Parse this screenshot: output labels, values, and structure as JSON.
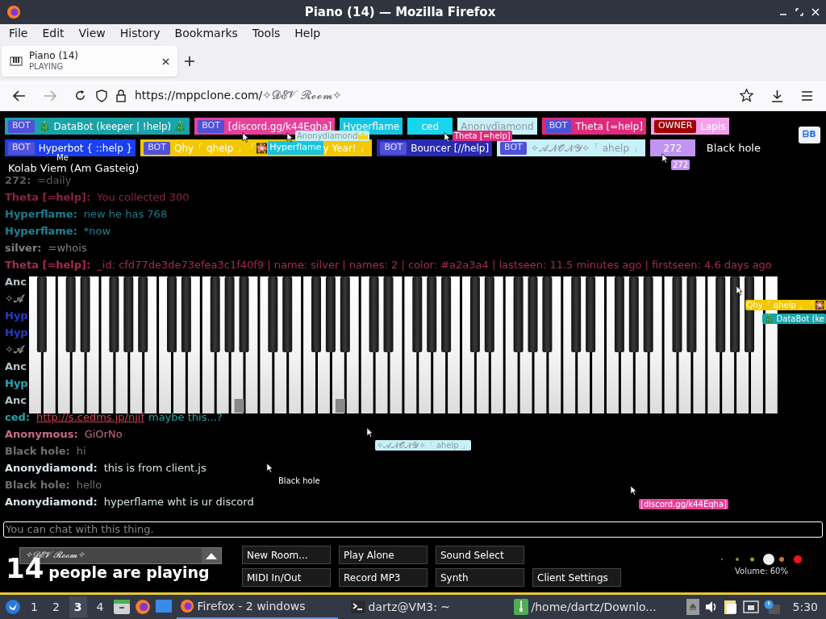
{
  "window": {
    "title": "Piano (14) — Mozilla Firefox"
  },
  "menu": [
    "File",
    "Edit",
    "View",
    "History",
    "Bookmarks",
    "Tools",
    "Help"
  ],
  "tabs": [
    {
      "title": "Piano (14)",
      "status": "PLAYING",
      "selected": true
    }
  ],
  "address": {
    "host": "https://mppclone.com/",
    "path": "✧𝓓𝓔𝓥 𝓡𝓸𝓸𝓶✧"
  },
  "tag_rows": [
    [
      {
        "kind": "tag",
        "badge": "BOT",
        "label": "🎄 DataBot (keeper | !help) 🎄",
        "color": "#1aa3a8"
      },
      {
        "kind": "tag",
        "badge": "BOT",
        "label": "[discord.gg/k44Eqha]",
        "color": "#e8409a"
      },
      {
        "kind": "tag",
        "label": "Hyperflame",
        "color": "#16c4e0"
      },
      {
        "kind": "tag",
        "label": "ced",
        "color": "#18d4ec"
      },
      {
        "kind": "tag",
        "label": "Anonydiamond",
        "color": "#c8f0f8"
      },
      {
        "kind": "tag",
        "badge": "BOT",
        "label": "Theta [=help]",
        "color": "#e02a7c"
      },
      {
        "kind": "tag",
        "badge": "OWNER",
        "label": "Lapis",
        "color": "#f4a0ec"
      }
    ],
    [
      {
        "kind": "tag",
        "badge": "BOT",
        "label": "Hyperbot { ::help }",
        "color": "#1a40f0"
      },
      {
        "kind": "tag",
        "badge": "BOT",
        "label": "Qhy「 qhelp 」「🎇",
        "cursor_label": "Hyperflame",
        "label_tail": "y Year! 」",
        "color": "#f4c800"
      },
      {
        "kind": "tag",
        "badge": "BOT",
        "label": "Bouncer [//help]",
        "color": "#2a2ab4"
      },
      {
        "kind": "tag",
        "badge": "BOT",
        "label": "✧𝓐𝓝𝓞𝓝𝓨✧「 ahelp 」",
        "color": "#c8f0f8"
      },
      {
        "kind": "tag",
        "label": "272",
        "color": "#c094f0"
      },
      {
        "kind": "plain",
        "label": "Black hole"
      }
    ]
  ],
  "bb_button": "ᗷB",
  "me": {
    "marker": "Me",
    "name": "Kolab Viem (Am Gasteig)"
  },
  "chat": [
    {
      "name": "272:",
      "text": "=daily",
      "color": "#5c5c5c"
    },
    {
      "name": "Theta [=help]:",
      "text": "You collected 300",
      "color": "#8c2444"
    },
    {
      "name": "Hyperflame:",
      "text": "new he has 768",
      "color": "#1a7c8a"
    },
    {
      "name": "Hyperflame:",
      "text": "*now",
      "color": "#1a8494"
    },
    {
      "name": "silver:",
      "text": "=whois",
      "color": "#808182"
    },
    {
      "name": "Theta [=help]:",
      "text": "_id: cfd77de3de73efea3c1f40f9 | name: silver | names: 2 | color: #a2a3a4 | lastseen: 11.5 minutes ago | firstseen: 4.6 days ago",
      "color": "#a82a4c"
    },
    {
      "name": "Anc",
      "color": "#b0c4c8"
    },
    {
      "name": "✧𝒜",
      "color": "#909090"
    },
    {
      "name": "Hyp",
      "color": "#2838c8"
    },
    {
      "name": "Hyp",
      "color": "#2838c8"
    },
    {
      "name": "✧𝒜",
      "color": "#909090"
    },
    {
      "name": "Anc",
      "color": "#b0c4c8"
    },
    {
      "name": "Hyp",
      "color": "#20a8b8"
    },
    {
      "name": "Anc",
      "color": "#b0c4c8"
    },
    {
      "name": "ced:",
      "link": "http://s.cedms.jp/njif",
      "text": "maybe this...?",
      "color": "#20a8a8"
    },
    {
      "name": "Anonymous:",
      "text": "GiOrNo",
      "color": "#c86a8c"
    },
    {
      "name": "Black hole:",
      "text": "hi",
      "color": "#707070"
    },
    {
      "name": "Anonydiamond:",
      "text": "this is from client.js",
      "color": "#d8e4e8"
    },
    {
      "name": "Black hole:",
      "text": "hello",
      "color": "#707070"
    },
    {
      "name": "Anonydiamond:",
      "text": "hyperflame wht is ur discord",
      "color": "#d8e4e8"
    }
  ],
  "cursors": [
    {
      "label": "Anonydiamond",
      "color": "#c8f0f8",
      "crown": true
    },
    {
      "label": "Theta [=help]",
      "color": "#e02a7c",
      "crown": false
    },
    {
      "label": "272",
      "color": "#c094f0",
      "crown": false
    },
    {
      "label": "Qhy「 qhelp 」「🎇",
      "color": "#f4c800",
      "crown": false
    },
    {
      "label": "🎄 DataBot (ke",
      "color": "#1aa3a8",
      "crown": false
    },
    {
      "label": "✧𝓐𝓝𝓞𝓝𝓨✧「 ahelp 」",
      "color": "#c8f0f8",
      "crown": false
    },
    {
      "label": "Black hole",
      "crown": false
    },
    {
      "label": "[discord.gg/k44Eqha]",
      "color": "#e8409a",
      "crown": false
    }
  ],
  "chat_input": {
    "placeholder": "You can chat with this thing."
  },
  "room": {
    "name": "✧𝓓𝓔𝓥 𝓡𝓸𝓸𝓶✧"
  },
  "player_count": {
    "count": "14",
    "caption": "people are playing"
  },
  "button_rows": [
    [
      "New Room...",
      "Play Alone",
      "Sound Select"
    ],
    [
      "MIDI In/Out",
      "Record MP3",
      "Synth",
      "Client Settings"
    ]
  ],
  "volume": {
    "level": 0.6,
    "reading": "Volume: 60%"
  },
  "taskbar": {
    "workspaces": [
      {
        "label": "1",
        "selected": false
      },
      {
        "label": "2",
        "selected": false
      },
      {
        "label": "3",
        "selected": true
      },
      {
        "label": "4",
        "selected": false
      }
    ],
    "tasks": [
      {
        "kind": "firefox",
        "label": "Firefox - 2 windows",
        "selected": true
      },
      {
        "kind": "terminal",
        "label": "dartz@VM3: ~",
        "selected": false
      },
      {
        "kind": "archive",
        "label": "/home/dartz/Downlo...",
        "selected": false
      }
    ],
    "clock": "5:30"
  }
}
